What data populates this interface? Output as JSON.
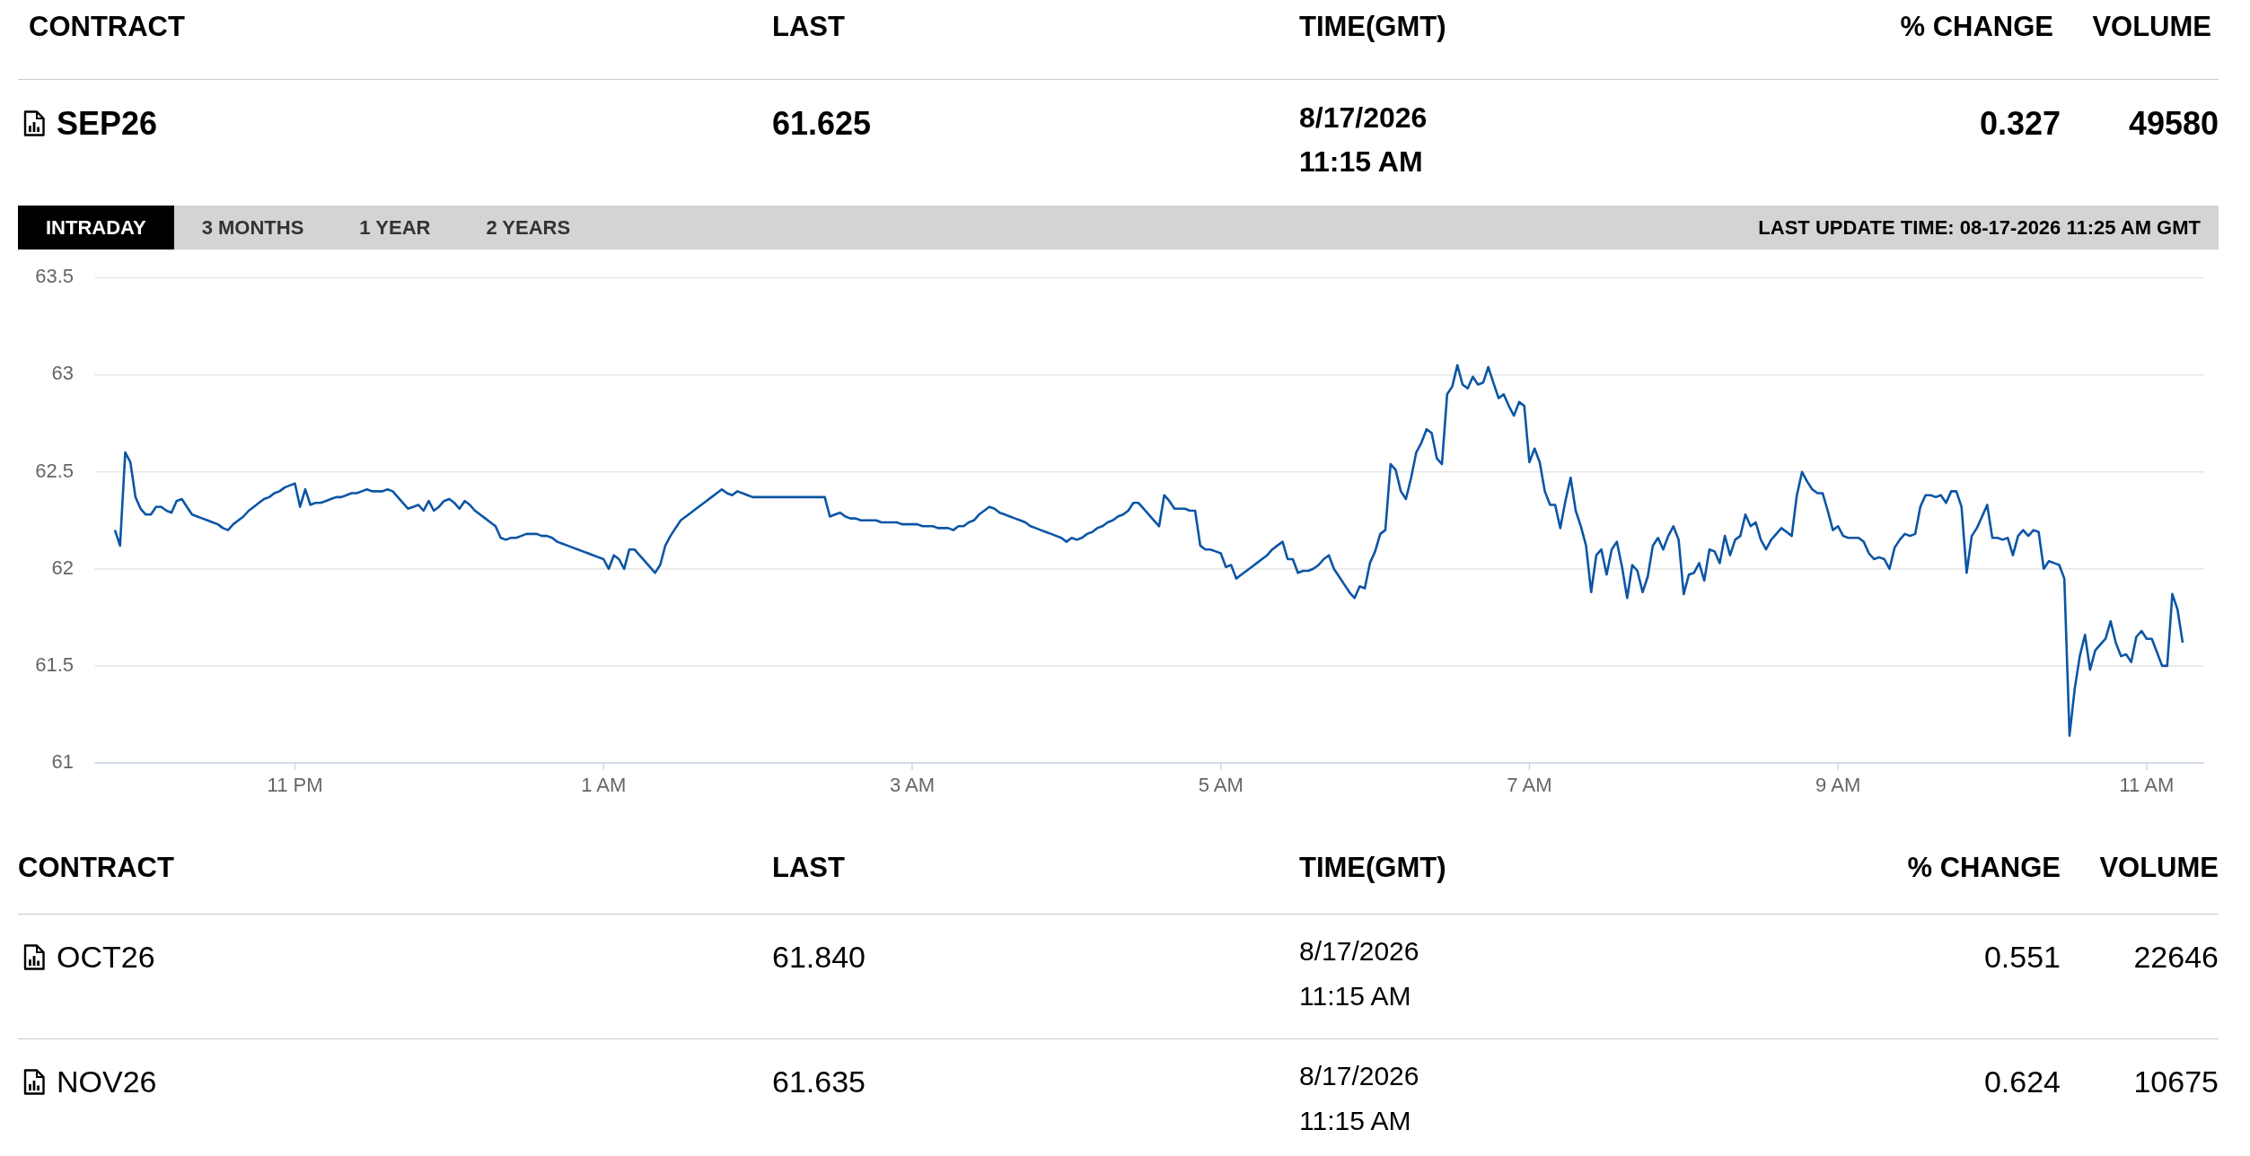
{
  "main_contract": {
    "columns": [
      "CONTRACT",
      "LAST",
      "TIME(GMT)",
      "% CHANGE",
      "VOLUME"
    ],
    "row": {
      "contract": "SEP26",
      "last": "61.625",
      "date": "8/17/2026",
      "time": "11:15 AM",
      "change": "0.327",
      "volume": "49580"
    }
  },
  "chart_panel": {
    "tabs": [
      {
        "label": "INTRADAY",
        "selected": true
      },
      {
        "label": "3 MONTHS",
        "selected": false
      },
      {
        "label": "1 YEAR",
        "selected": false
      },
      {
        "label": "2 YEARS",
        "selected": false
      }
    ],
    "last_update": "LAST UPDATE TIME: 08-17-2026 11:25 AM GMT",
    "chart_data": {
      "type": "line",
      "grid": true,
      "ylim": [
        61,
        63.5
      ],
      "yticks": [
        61,
        61.5,
        62,
        62.5,
        63,
        63.5
      ],
      "categories": [
        null,
        null,
        null,
        null,
        null,
        null,
        null,
        null,
        null,
        null,
        null,
        null,
        null,
        null,
        null,
        null,
        null,
        null,
        null,
        null,
        null,
        null,
        null,
        null,
        null,
        null,
        null,
        null,
        null,
        null,
        null,
        null,
        null,
        null,
        null,
        "11 PM",
        null,
        null,
        null,
        null,
        null,
        null,
        null,
        null,
        null,
        null,
        null,
        null,
        null,
        null,
        null,
        null,
        null,
        null,
        null,
        null,
        null,
        null,
        null,
        null,
        null,
        null,
        null,
        null,
        null,
        null,
        null,
        null,
        null,
        null,
        null,
        null,
        null,
        null,
        null,
        null,
        null,
        null,
        null,
        null,
        null,
        null,
        null,
        null,
        null,
        null,
        null,
        null,
        null,
        null,
        null,
        null,
        null,
        null,
        null,
        "1 AM",
        null,
        null,
        null,
        null,
        null,
        null,
        null,
        null,
        null,
        null,
        null,
        null,
        null,
        null,
        null,
        null,
        null,
        null,
        null,
        null,
        null,
        null,
        null,
        null,
        null,
        null,
        null,
        null,
        null,
        null,
        null,
        null,
        null,
        null,
        null,
        null,
        null,
        null,
        null,
        null,
        null,
        null,
        null,
        null,
        null,
        null,
        null,
        null,
        null,
        null,
        null,
        null,
        null,
        null,
        null,
        null,
        null,
        null,
        null,
        "3 AM",
        null,
        null,
        null,
        null,
        null,
        null,
        null,
        null,
        null,
        null,
        null,
        null,
        null,
        null,
        null,
        null,
        null,
        null,
        null,
        null,
        null,
        null,
        null,
        null,
        null,
        null,
        null,
        null,
        null,
        null,
        null,
        null,
        null,
        null,
        null,
        null,
        null,
        null,
        null,
        null,
        null,
        null,
        null,
        null,
        null,
        null,
        null,
        null,
        null,
        null,
        null,
        null,
        null,
        null,
        null,
        null,
        null,
        null,
        null,
        "5 AM",
        null,
        null,
        null,
        null,
        null,
        null,
        null,
        null,
        null,
        null,
        null,
        null,
        null,
        null,
        null,
        null,
        null,
        null,
        null,
        null,
        null,
        null,
        null,
        null,
        null,
        null,
        null,
        null,
        null,
        null,
        null,
        null,
        null,
        null,
        null,
        null,
        null,
        null,
        null,
        null,
        null,
        null,
        null,
        null,
        null,
        null,
        null,
        null,
        null,
        null,
        null,
        null,
        null,
        null,
        null,
        null,
        null,
        null,
        null,
        "7 AM",
        null,
        null,
        null,
        null,
        null,
        null,
        null,
        null,
        null,
        null,
        null,
        null,
        null,
        null,
        null,
        null,
        null,
        null,
        null,
        null,
        null,
        null,
        null,
        null,
        null,
        null,
        null,
        null,
        null,
        null,
        null,
        null,
        null,
        null,
        null,
        null,
        null,
        null,
        null,
        null,
        null,
        null,
        null,
        null,
        null,
        null,
        null,
        null,
        null,
        null,
        null,
        null,
        null,
        null,
        null,
        null,
        null,
        null,
        null,
        "9 AM",
        null,
        null,
        null,
        null,
        null,
        null,
        null,
        null,
        null,
        null,
        null,
        null,
        null,
        null,
        null,
        null,
        null,
        null,
        null,
        null,
        null,
        null,
        null,
        null,
        null,
        null,
        null,
        null,
        null,
        null,
        null,
        null,
        null,
        null,
        null,
        null,
        null,
        null,
        null,
        null,
        null,
        null,
        null,
        null,
        null,
        null,
        null,
        null,
        null,
        null,
        null,
        null,
        null,
        null,
        null,
        null,
        null,
        null,
        null,
        "11 AM",
        null,
        null,
        null,
        null,
        null,
        null,
        null
      ],
      "series": [
        {
          "color": "#0b55a5",
          "values": [
            62.2,
            62.12,
            62.6,
            62.55,
            62.37,
            62.31,
            62.28,
            62.28,
            62.32,
            62.32,
            62.3,
            62.29,
            62.35,
            62.36,
            62.32,
            62.28,
            62.27,
            62.26,
            62.25,
            62.24,
            62.23,
            62.21,
            62.2,
            62.23,
            62.25,
            62.27,
            62.3,
            62.32,
            62.34,
            62.36,
            62.37,
            62.39,
            62.4,
            62.42,
            62.43,
            62.44,
            62.32,
            62.41,
            62.33,
            62.34,
            62.34,
            62.35,
            62.36,
            62.37,
            62.37,
            62.38,
            62.39,
            62.39,
            62.4,
            62.41,
            62.4,
            62.4,
            62.4,
            62.41,
            62.4,
            62.37,
            62.34,
            62.31,
            62.32,
            62.33,
            62.3,
            62.35,
            62.3,
            62.32,
            62.35,
            62.36,
            62.34,
            62.31,
            62.35,
            62.33,
            62.3,
            62.28,
            62.26,
            62.24,
            62.22,
            62.16,
            62.15,
            62.16,
            62.16,
            62.17,
            62.18,
            62.18,
            62.18,
            62.17,
            62.17,
            62.16,
            62.14,
            62.13,
            62.12,
            62.11,
            62.1,
            62.09,
            62.08,
            62.07,
            62.06,
            62.05,
            62.0,
            62.07,
            62.05,
            62.0,
            62.1,
            62.1,
            62.07,
            62.04,
            62.01,
            61.98,
            62.02,
            62.12,
            62.17,
            62.21,
            62.25,
            62.27,
            62.29,
            62.31,
            62.33,
            62.35,
            62.37,
            62.39,
            62.41,
            62.39,
            62.38,
            62.4,
            62.39,
            62.38,
            62.37,
            62.37,
            62.37,
            62.37,
            62.37,
            62.37,
            62.37,
            62.37,
            62.37,
            62.37,
            62.37,
            62.37,
            62.37,
            62.37,
            62.37,
            62.27,
            62.28,
            62.29,
            62.27,
            62.26,
            62.26,
            62.25,
            62.25,
            62.25,
            62.25,
            62.24,
            62.24,
            62.24,
            62.24,
            62.23,
            62.23,
            62.23,
            62.23,
            62.22,
            62.22,
            62.22,
            62.21,
            62.21,
            62.21,
            62.2,
            62.22,
            62.22,
            62.24,
            62.25,
            62.28,
            62.3,
            62.32,
            62.31,
            62.29,
            62.28,
            62.27,
            62.26,
            62.25,
            62.24,
            62.22,
            62.21,
            62.2,
            62.19,
            62.18,
            62.17,
            62.16,
            62.14,
            62.16,
            62.15,
            62.16,
            62.18,
            62.19,
            62.21,
            62.22,
            62.24,
            62.25,
            62.27,
            62.28,
            62.3,
            62.34,
            62.34,
            62.31,
            62.28,
            62.25,
            62.22,
            62.38,
            62.35,
            62.31,
            62.31,
            62.31,
            62.3,
            62.3,
            62.12,
            62.1,
            62.1,
            62.09,
            62.08,
            62.01,
            62.02,
            61.95,
            61.97,
            61.99,
            62.01,
            62.03,
            62.05,
            62.07,
            62.1,
            62.12,
            62.14,
            62.05,
            62.05,
            61.98,
            61.99,
            61.99,
            62.0,
            62.02,
            62.05,
            62.07,
            62.0,
            61.96,
            61.92,
            61.88,
            61.85,
            61.91,
            61.9,
            62.03,
            62.09,
            62.18,
            62.2,
            62.54,
            62.51,
            62.4,
            62.36,
            62.47,
            62.6,
            62.65,
            62.72,
            62.7,
            62.57,
            62.54,
            62.9,
            62.94,
            63.05,
            62.95,
            62.93,
            62.99,
            62.95,
            62.96,
            63.04,
            62.96,
            62.88,
            62.9,
            62.84,
            62.79,
            62.86,
            62.84,
            62.55,
            62.62,
            62.55,
            62.4,
            62.33,
            62.33,
            62.21,
            62.35,
            62.47,
            62.3,
            62.22,
            62.12,
            61.88,
            62.07,
            62.1,
            61.97,
            62.1,
            62.14,
            62.01,
            61.85,
            62.02,
            61.99,
            61.88,
            61.96,
            62.12,
            62.16,
            62.1,
            62.17,
            62.22,
            62.15,
            61.87,
            61.97,
            61.98,
            62.03,
            61.94,
            62.1,
            62.09,
            62.03,
            62.17,
            62.07,
            62.15,
            62.17,
            62.28,
            62.22,
            62.24,
            62.15,
            62.1,
            62.15,
            62.18,
            62.21,
            62.19,
            62.17,
            62.38,
            62.5,
            62.45,
            62.41,
            62.39,
            62.39,
            62.3,
            62.2,
            62.22,
            62.17,
            62.16,
            62.16,
            62.16,
            62.14,
            62.08,
            62.05,
            62.06,
            62.05,
            62.0,
            62.11,
            62.15,
            62.18,
            62.17,
            62.18,
            62.32,
            62.38,
            62.38,
            62.37,
            62.38,
            62.34,
            62.4,
            62.4,
            62.32,
            61.98,
            62.17,
            62.21,
            62.27,
            62.33,
            62.16,
            62.16,
            62.15,
            62.16,
            62.07,
            62.17,
            62.2,
            62.17,
            62.2,
            62.19,
            62.0,
            62.04,
            62.03,
            62.02,
            61.95,
            61.14,
            61.38,
            61.55,
            61.66,
            61.48,
            61.58,
            61.61,
            61.64,
            61.73,
            61.62,
            61.55,
            61.56,
            61.52,
            61.65,
            61.68,
            61.64,
            61.64,
            61.57,
            61.5,
            61.5,
            61.87,
            61.79,
            61.62
          ]
        }
      ]
    }
  },
  "contracts_table": {
    "columns": [
      "CONTRACT",
      "LAST",
      "TIME(GMT)",
      "% CHANGE",
      "VOLUME"
    ],
    "rows": [
      {
        "contract": "OCT26",
        "last": "61.840",
        "date": "8/17/2026",
        "time": "11:15 AM",
        "change": "0.551",
        "volume": "22646"
      },
      {
        "contract": "NOV26",
        "last": "61.635",
        "date": "8/17/2026",
        "time": "11:15 AM",
        "change": "0.624",
        "volume": "10675"
      }
    ]
  }
}
